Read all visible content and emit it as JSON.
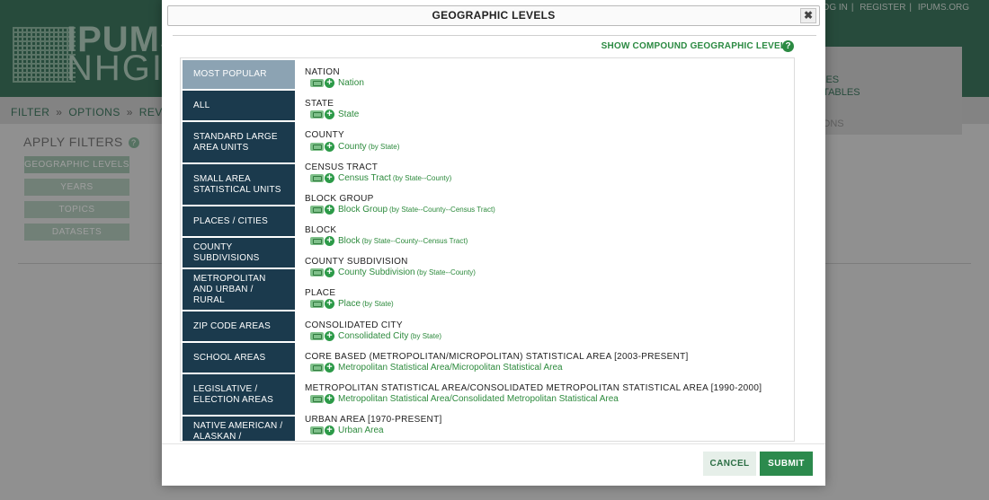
{
  "background": {
    "logo_line1": "IPUMS",
    "logo_line2": "NHGIS",
    "top_links": [
      "LOG IN",
      "REGISTER",
      "IPUMS.ORG"
    ],
    "breadcrumb": [
      "FILTER",
      "OPTIONS",
      "REVIEW"
    ],
    "breadcrumb_sep": "»",
    "table_items": [
      "BLES",
      "S TABLES",
      "TIONS"
    ],
    "apply_filters": "APPLY FILTERS",
    "help_glyph": "?",
    "filters": [
      "GEOGRAPHIC LEVELS",
      "YEARS",
      "TOPICS",
      "DATASETS"
    ]
  },
  "modal": {
    "title": "GEOGRAPHIC LEVELS",
    "close_glyph": "✖",
    "compound_link": "SHOW COMPOUND GEOGRAPHIC LEVELS",
    "help_glyph": "?",
    "sidebar": [
      {
        "label": "MOST POPULAR",
        "active": true
      },
      {
        "label": "ALL",
        "active": false
      },
      {
        "label": "STANDARD LARGE AREA UNITS",
        "active": false
      },
      {
        "label": "SMALL AREA STATISTICAL UNITS",
        "active": false
      },
      {
        "label": "PLACES / CITIES",
        "active": false
      },
      {
        "label": "COUNTY SUBDIVISIONS",
        "active": false
      },
      {
        "label": "METROPOLITAN AND URBAN / RURAL",
        "active": false
      },
      {
        "label": "ZIP CODE AREAS",
        "active": false
      },
      {
        "label": "SCHOOL AREAS",
        "active": false
      },
      {
        "label": "LEGISLATIVE / ELECTION AREAS",
        "active": false
      },
      {
        "label": "NATIVE AMERICAN / ALASKAN / HAWAIIAN",
        "active": false
      }
    ],
    "levels": [
      {
        "heading": "NATION",
        "link": "Nation",
        "by": ""
      },
      {
        "heading": "STATE",
        "link": "State",
        "by": ""
      },
      {
        "heading": "COUNTY",
        "link": "County",
        "by": "(by State)"
      },
      {
        "heading": "CENSUS TRACT",
        "link": "Census Tract",
        "by": "(by State--County)"
      },
      {
        "heading": "BLOCK GROUP",
        "link": "Block Group",
        "by": "(by State--County--Census Tract)"
      },
      {
        "heading": "BLOCK",
        "link": "Block",
        "by": "(by State--County--Census Tract)"
      },
      {
        "heading": "COUNTY SUBDIVISION",
        "link": "County Subdivision",
        "by": "(by State--County)"
      },
      {
        "heading": "PLACE",
        "link": "Place",
        "by": "(by State)"
      },
      {
        "heading": "CONSOLIDATED CITY",
        "link": "Consolidated City",
        "by": "(by State)"
      },
      {
        "heading": "CORE BASED (METROPOLITAN/MICROPOLITAN) STATISTICAL AREA [2003-PRESENT]",
        "link": "Metropolitan Statistical Area/Micropolitan Statistical Area",
        "by": ""
      },
      {
        "heading": "METROPOLITAN STATISTICAL AREA/CONSOLIDATED METROPOLITAN STATISTICAL AREA [1990-2000]",
        "link": "Metropolitan Statistical Area/Consolidated Metropolitan Statistical Area",
        "by": ""
      },
      {
        "heading": "URBAN AREA [1970-PRESENT]",
        "link": "Urban Area",
        "by": ""
      }
    ],
    "cancel_label": "CANCEL",
    "submit_label": "SUBMIT"
  },
  "colors": {
    "brand_green": "#3f7a62",
    "link_green": "#2c8a3c",
    "sidebar_navy": "#1b3a4d",
    "sidebar_active": "#8ca3b3"
  }
}
